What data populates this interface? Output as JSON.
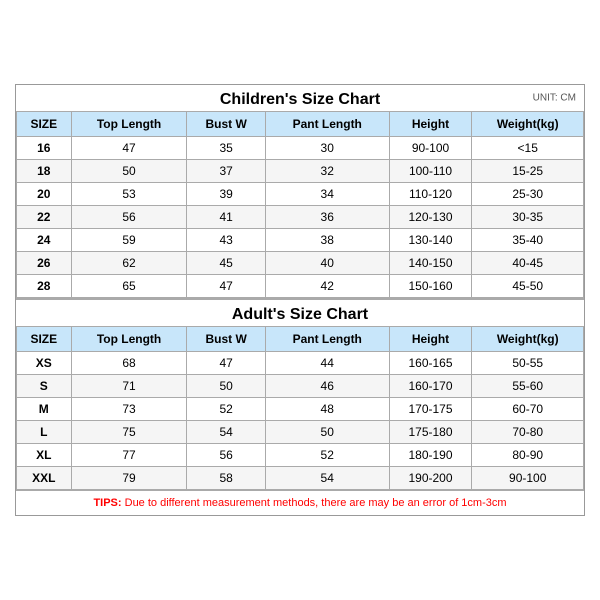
{
  "children_title": "Children's Size Chart",
  "adult_title": "Adult's Size Chart",
  "unit": "UNIT: CM",
  "tips": "TIPS: Due to different measurement methods, there are may be an error of 1cm-3cm",
  "tips_label": "TIPS:",
  "tips_body": " Due to different measurement methods, there are may be an error of 1cm-3cm",
  "headers": [
    "SIZE",
    "Top Length",
    "Bust W",
    "Pant Length",
    "Height",
    "Weight(kg)"
  ],
  "children_rows": [
    [
      "16",
      "47",
      "35",
      "30",
      "90-100",
      "<15"
    ],
    [
      "18",
      "50",
      "37",
      "32",
      "100-110",
      "15-25"
    ],
    [
      "20",
      "53",
      "39",
      "34",
      "110-120",
      "25-30"
    ],
    [
      "22",
      "56",
      "41",
      "36",
      "120-130",
      "30-35"
    ],
    [
      "24",
      "59",
      "43",
      "38",
      "130-140",
      "35-40"
    ],
    [
      "26",
      "62",
      "45",
      "40",
      "140-150",
      "40-45"
    ],
    [
      "28",
      "65",
      "47",
      "42",
      "150-160",
      "45-50"
    ]
  ],
  "adult_rows": [
    [
      "XS",
      "68",
      "47",
      "44",
      "160-165",
      "50-55"
    ],
    [
      "S",
      "71",
      "50",
      "46",
      "160-170",
      "55-60"
    ],
    [
      "M",
      "73",
      "52",
      "48",
      "170-175",
      "60-70"
    ],
    [
      "L",
      "75",
      "54",
      "50",
      "175-180",
      "70-80"
    ],
    [
      "XL",
      "77",
      "56",
      "52",
      "180-190",
      "80-90"
    ],
    [
      "XXL",
      "79",
      "58",
      "54",
      "190-200",
      "90-100"
    ]
  ]
}
